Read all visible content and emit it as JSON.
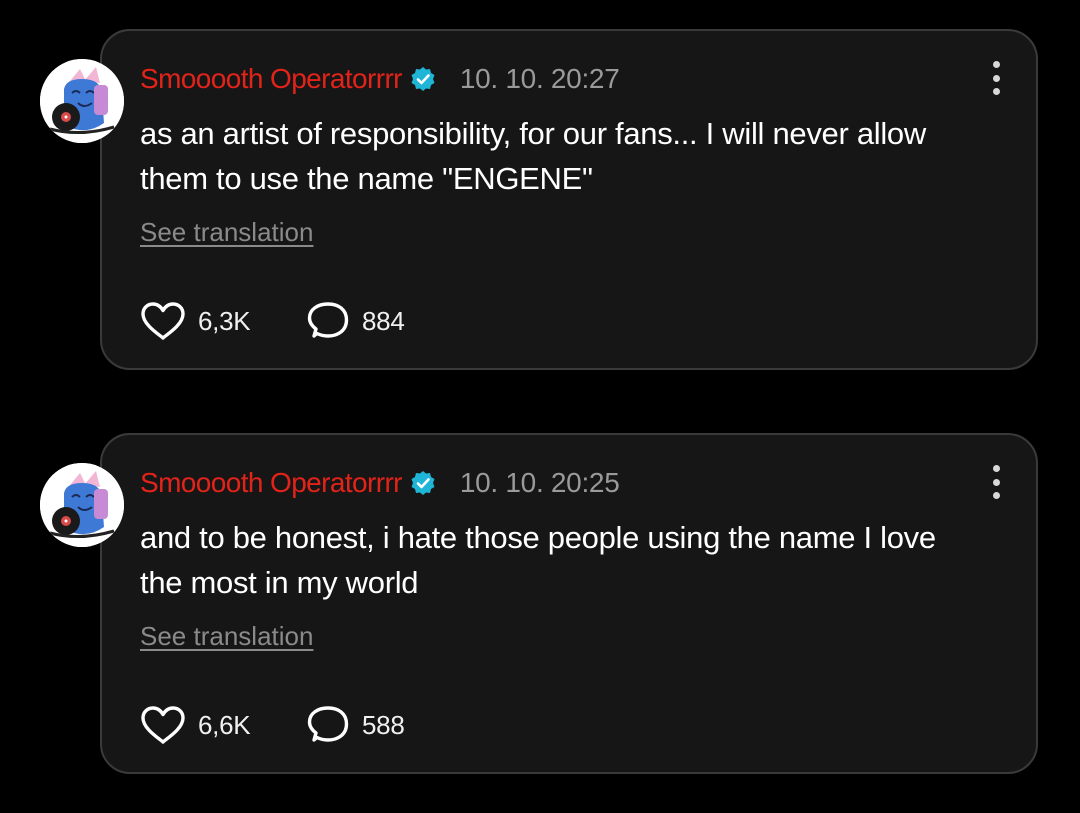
{
  "colors": {
    "background": "#000000",
    "card": "#161616",
    "card_border": "#3a3a3a",
    "username": "#e2231a",
    "verified_badge": "#1fb5d6",
    "muted_text": "#9a9a9a"
  },
  "posts": [
    {
      "username": "Smooooth Operatorrrr",
      "verified": true,
      "timestamp": "10. 10. 20:27",
      "text": "as an artist of responsibility, for our fans... I will never allow them to use the name \"ENGENE\"",
      "see_translation": "See translation",
      "likes": "6,3K",
      "replies": "884",
      "icons": {
        "like": "heart-icon",
        "reply": "speech-bubble-icon",
        "more": "more-vertical-icon",
        "badge": "verified-badge-icon"
      }
    },
    {
      "username": "Smooooth Operatorrrr",
      "verified": true,
      "timestamp": "10. 10. 20:25",
      "text": "and to be honest, i hate those people using the name I love the most in my world",
      "see_translation": "See translation",
      "likes": "6,6K",
      "replies": "588",
      "icons": {
        "like": "heart-icon",
        "reply": "speech-bubble-icon",
        "more": "more-vertical-icon",
        "badge": "verified-badge-icon"
      }
    }
  ]
}
